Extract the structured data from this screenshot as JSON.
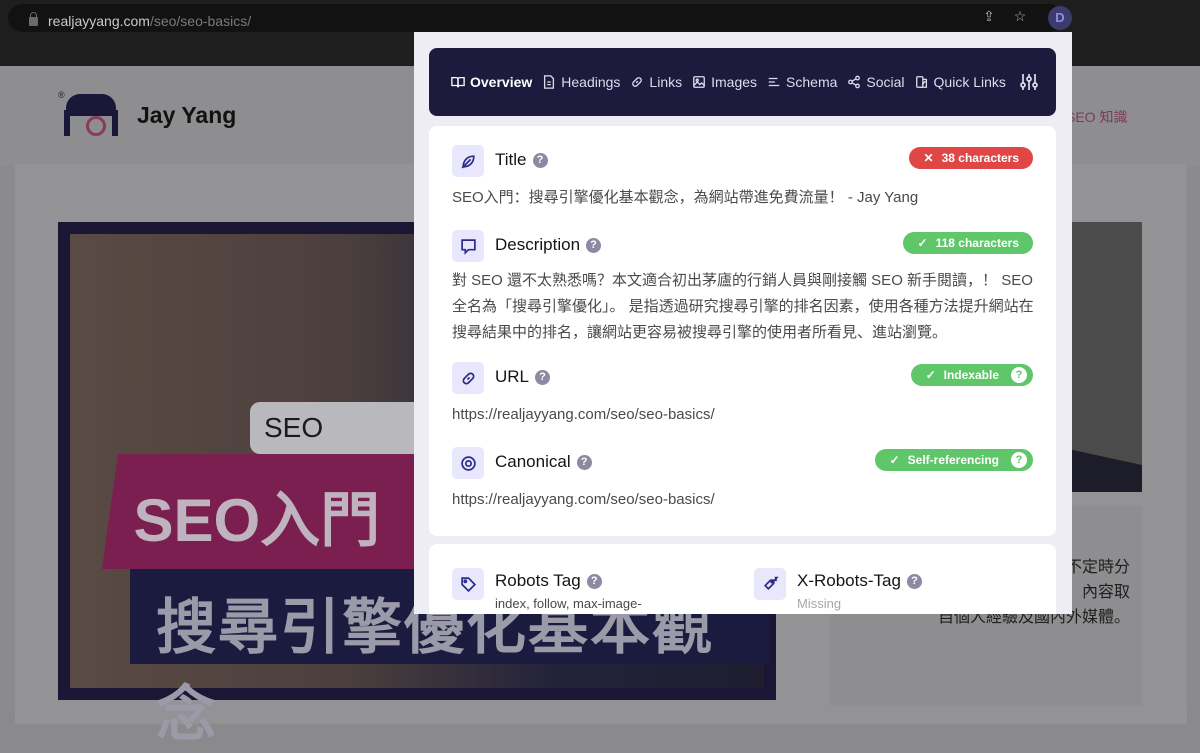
{
  "browser": {
    "url_host": "realjayyang.com",
    "url_path": "/seo/seo-basics/",
    "extension_badge": "D"
  },
  "site": {
    "name": "Jay Yang",
    "logo_mark": "®",
    "nav_item": "SEO 知識",
    "hero_seo_box": "SEO",
    "hero_title": "SEO入門",
    "hero_subtitle": "搜尋引擎優化基本觀念",
    "side_text": [
      "不定時分",
      "，內容取",
      "自個人經驗及國內外媒體。"
    ]
  },
  "popup": {
    "tabs": [
      {
        "label": "Overview",
        "icon": "book-open-icon",
        "active": true
      },
      {
        "label": "Headings",
        "icon": "document-icon",
        "active": false
      },
      {
        "label": "Links",
        "icon": "link-icon",
        "active": false
      },
      {
        "label": "Images",
        "icon": "image-icon",
        "active": false
      },
      {
        "label": "Schema",
        "icon": "bars-icon",
        "active": false
      },
      {
        "label": "Social",
        "icon": "share-icon",
        "active": false
      },
      {
        "label": "Quick Links",
        "icon": "quick-links-icon",
        "active": false
      }
    ],
    "settings_icon": "sliders-icon",
    "sections": {
      "title": {
        "label": "Title",
        "value": "SEO入門：搜尋引擎優化基本觀念，為網站帶進免費流量！ - Jay Yang",
        "badge": {
          "mark": "✕",
          "text": "38 characters",
          "status": "error",
          "color": "#e04646"
        }
      },
      "description": {
        "label": "Description",
        "value": "對 SEO 還不太熟悉嗎？本文適合初出茅廬的行銷人員與剛接觸 SEO 新手閱讀，！ SEO 全名為「搜尋引擎優化」。 是指透過研究搜尋引擎的排名因素，使用各種方法提升網站在搜尋結果中的排名，讓網站更容易被搜尋引擎的使用者所看見、進站瀏覽。",
        "badge": {
          "mark": "✓",
          "text": "118 characters",
          "status": "ok",
          "color": "#5fc66a"
        }
      },
      "url": {
        "label": "URL",
        "value": "https://realjayyang.com/seo/seo-basics/",
        "badge": {
          "mark": "✓",
          "text": "Indexable",
          "status": "ok",
          "color": "#5fc66a"
        }
      },
      "canonical": {
        "label": "Canonical",
        "value": "https://realjayyang.com/seo/seo-basics/",
        "badge": {
          "mark": "✓",
          "text": "Self-referencing",
          "status": "ok",
          "color": "#5fc66a"
        }
      },
      "robots_tag": {
        "label": "Robots Tag",
        "value": "index, follow, max-image-"
      },
      "x_robots_tag": {
        "label": "X-Robots-Tag",
        "value": "Missing"
      }
    },
    "help_glyph": "?"
  }
}
